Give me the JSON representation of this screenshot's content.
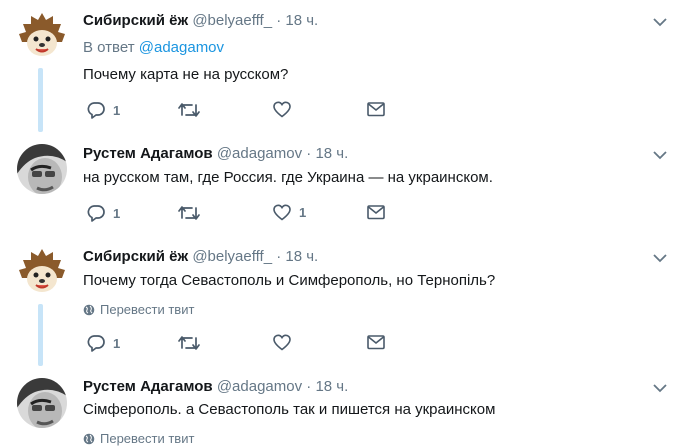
{
  "tweets": [
    {
      "name": "Сибирский ёж",
      "handle": "@belyaefff_",
      "time": "18 ч.",
      "reply_prefix": "В ответ",
      "reply_to": "@adagamov",
      "text": "Почему карта не на русском?",
      "replies": "1",
      "retweets": "",
      "likes": ""
    },
    {
      "name": "Рустем Адагамов",
      "handle": "@adagamov",
      "time": "18 ч.",
      "text": "на русском там, где Россия. где Украина — на украинском.",
      "replies": "1",
      "retweets": "",
      "likes": "1"
    },
    {
      "name": "Сибирский ёж",
      "handle": "@belyaefff_",
      "time": "18 ч.",
      "text": "Почему тогда Севастополь и Симферополь, но Тернопіль?",
      "translate": "Перевести твит",
      "replies": "1",
      "retweets": "",
      "likes": ""
    },
    {
      "name": "Рустем Адагамов",
      "handle": "@adagamov",
      "time": "18 ч.",
      "text": "Сімферополь. а Севастополь так и пишется на украинском",
      "translate": "Перевести твит"
    }
  ],
  "dot": "·",
  "colors": {
    "accent": "#1b95e0",
    "muted": "#657786",
    "thread": "#c7e4f8"
  },
  "icons": [
    "hedgehog-avatar",
    "man-avatar",
    "chevron-down-icon",
    "reply-icon",
    "retweet-icon",
    "like-icon",
    "direct-message-icon",
    "globe-icon"
  ]
}
